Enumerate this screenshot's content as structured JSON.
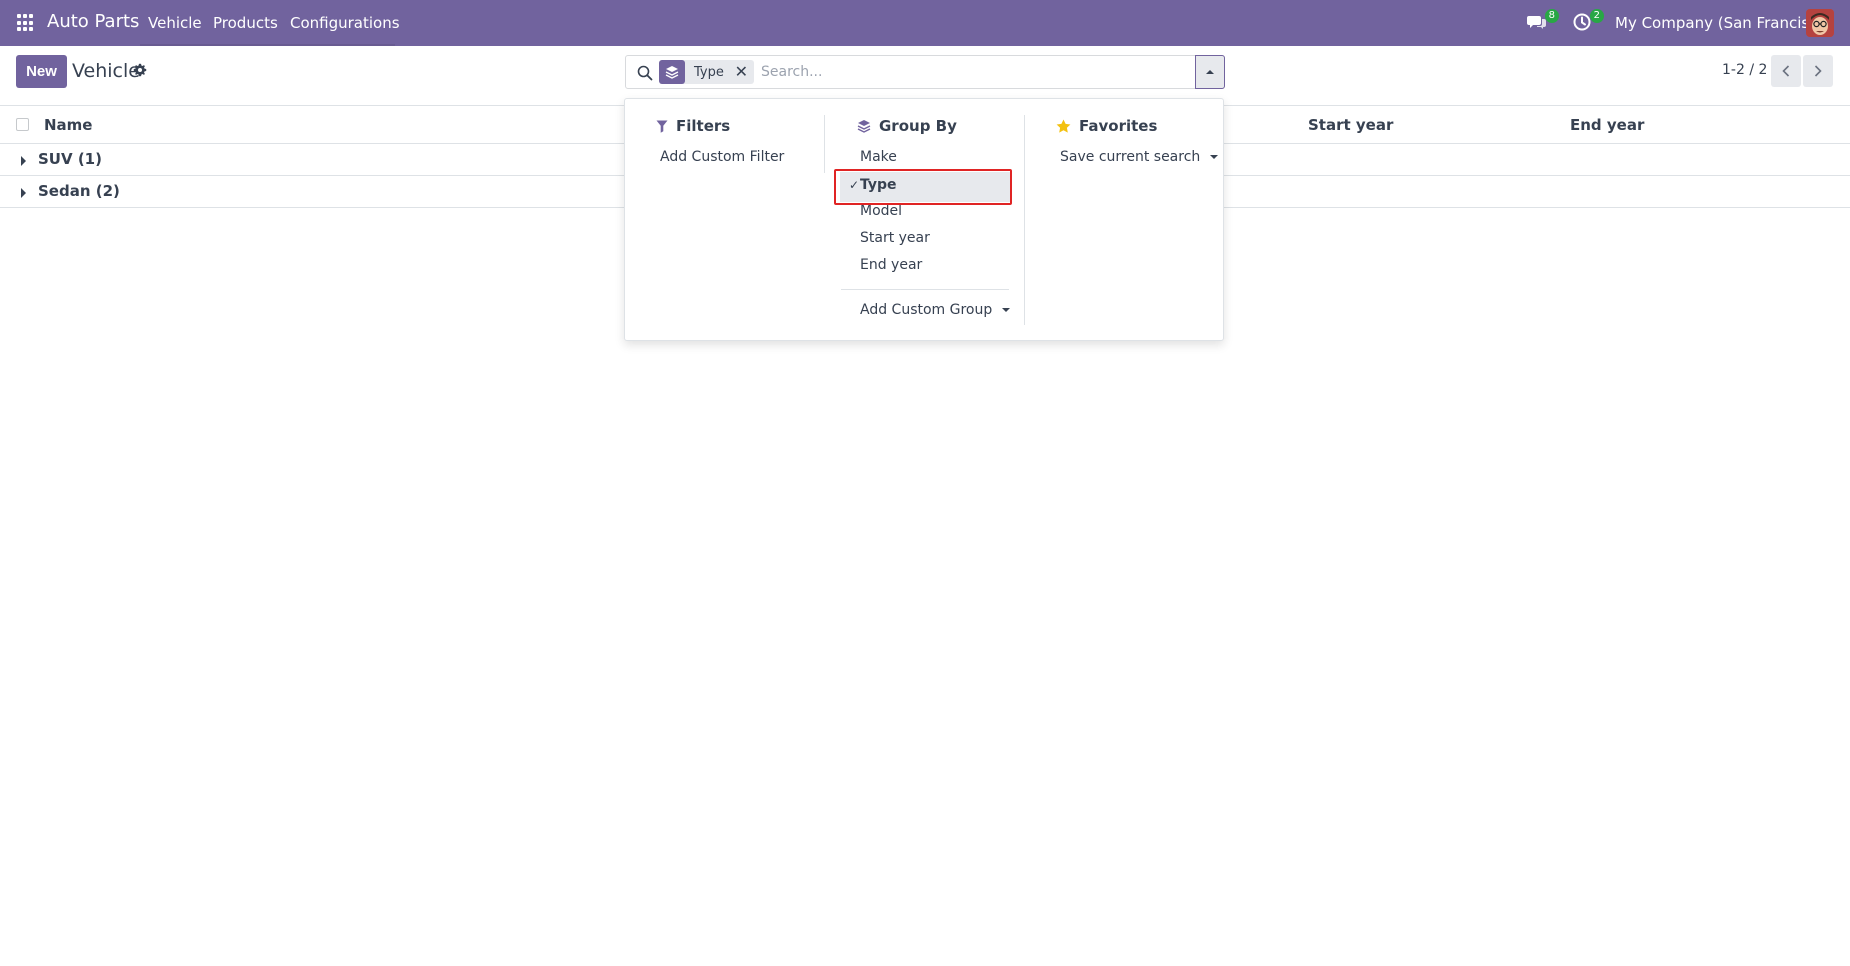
{
  "navbar": {
    "app_name": "Auto Parts",
    "menu": [
      "Vehicle",
      "Products",
      "Configurations"
    ],
    "chat_count": "8",
    "activity_count": "2",
    "company": "My Company (San Francisco)",
    "color": "#71639e"
  },
  "control_panel": {
    "new_label": "New",
    "title": "Vehicle",
    "pager": "1-2 / 2"
  },
  "search": {
    "facet_label": "Type",
    "placeholder": "Search..."
  },
  "list": {
    "columns": [
      "Name",
      "Start year",
      "End year"
    ],
    "groups": [
      {
        "label": "SUV (1)"
      },
      {
        "label": "Sedan (2)"
      }
    ]
  },
  "dropdown": {
    "filters": {
      "title": "Filters",
      "items": [
        "Add Custom Filter"
      ]
    },
    "group_by": {
      "title": "Group By",
      "items": [
        "Make",
        "Type",
        "Model",
        "Start year",
        "End year"
      ],
      "selected": "Type",
      "custom": "Add Custom Group"
    },
    "favorites": {
      "title": "Favorites",
      "items": [
        "Save current search"
      ]
    }
  }
}
